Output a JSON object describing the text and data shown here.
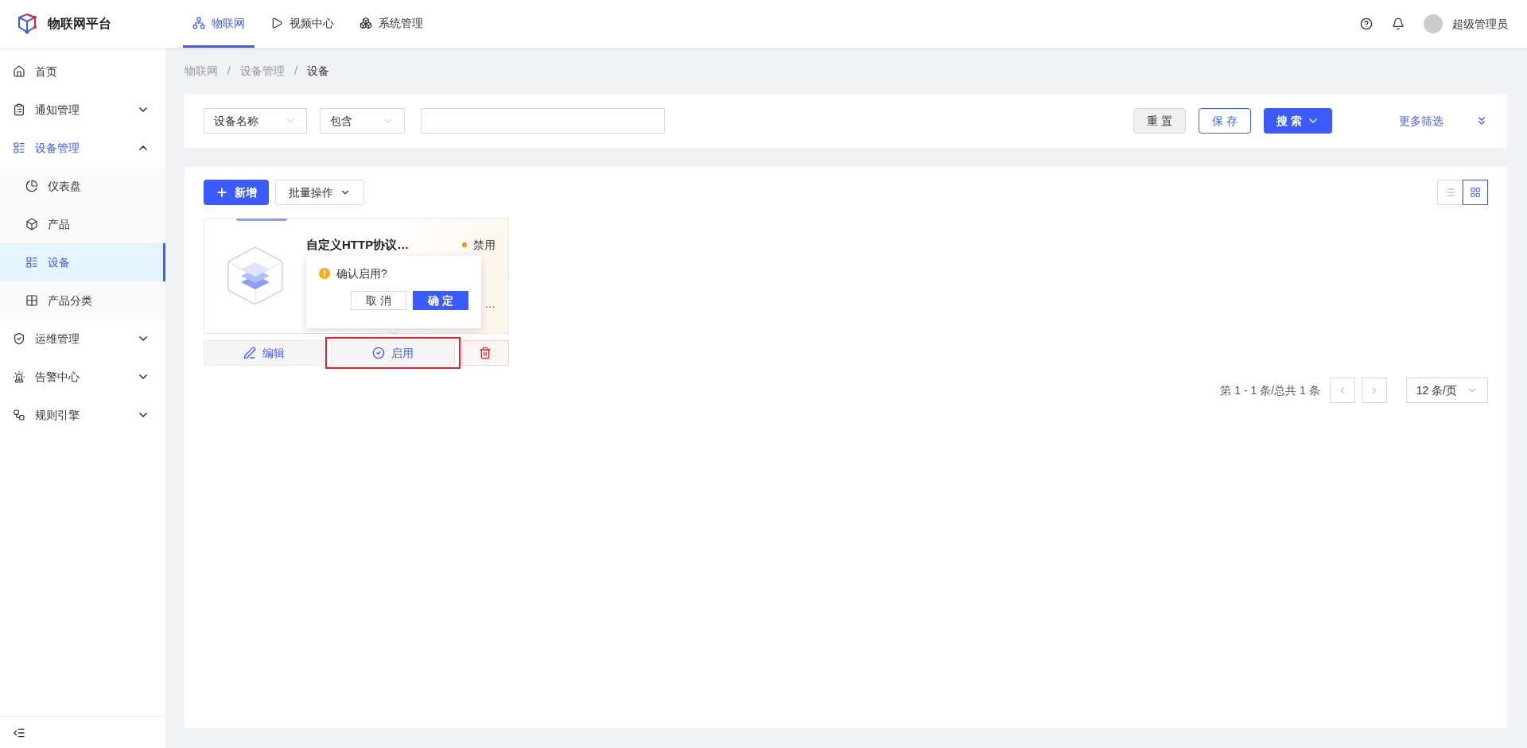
{
  "brand": {
    "name": "物联网平台"
  },
  "top_nav": [
    {
      "label": "物联网",
      "selected": true
    },
    {
      "label": "视频中心",
      "selected": false
    },
    {
      "label": "系统管理",
      "selected": false
    }
  ],
  "user": {
    "name": "超级管理员"
  },
  "sidebar": {
    "items": [
      {
        "label": "首页",
        "selected": false
      },
      {
        "label": "通知管理",
        "selected": false,
        "expanded": false
      },
      {
        "label": "设备管理",
        "selected": true,
        "expanded": true,
        "children": [
          {
            "label": "仪表盘",
            "selected": false
          },
          {
            "label": "产品",
            "selected": false
          },
          {
            "label": "设备",
            "selected": true
          },
          {
            "label": "产品分类",
            "selected": false
          }
        ]
      },
      {
        "label": "运维管理",
        "selected": false,
        "expanded": false
      },
      {
        "label": "告警中心",
        "selected": false,
        "expanded": false
      },
      {
        "label": "规则引擎",
        "selected": false,
        "expanded": false
      }
    ]
  },
  "breadcrumb": {
    "items": [
      "物联网",
      "设备管理",
      "设备"
    ],
    "separators": [
      "/",
      "/"
    ]
  },
  "filter": {
    "field": "设备名称",
    "operator": "包含",
    "reset": "重 置",
    "save": "保 存",
    "search": "搜 索",
    "more": "更多筛选"
  },
  "toolbar": {
    "add": "新增",
    "batch": "批量操作",
    "view_modes": [
      {
        "selected": false
      },
      {
        "selected": true
      }
    ]
  },
  "devices": [
    {
      "title": "自定义HTTP协议…",
      "status": "禁用",
      "color": "#fa8c16",
      "line_fragment": "…",
      "actions": {
        "edit": "编辑",
        "toggle": "启用",
        "toggle_highlighted": true
      }
    }
  ],
  "popconfirm": {
    "message": "确认启用?",
    "cancel": "取 消",
    "ok": "确 定"
  },
  "pagination": {
    "summary": "第 1 - 1 条/总共 1 条",
    "prev_disabled": true,
    "next_disabled": true,
    "page_size": "12 条/页"
  }
}
